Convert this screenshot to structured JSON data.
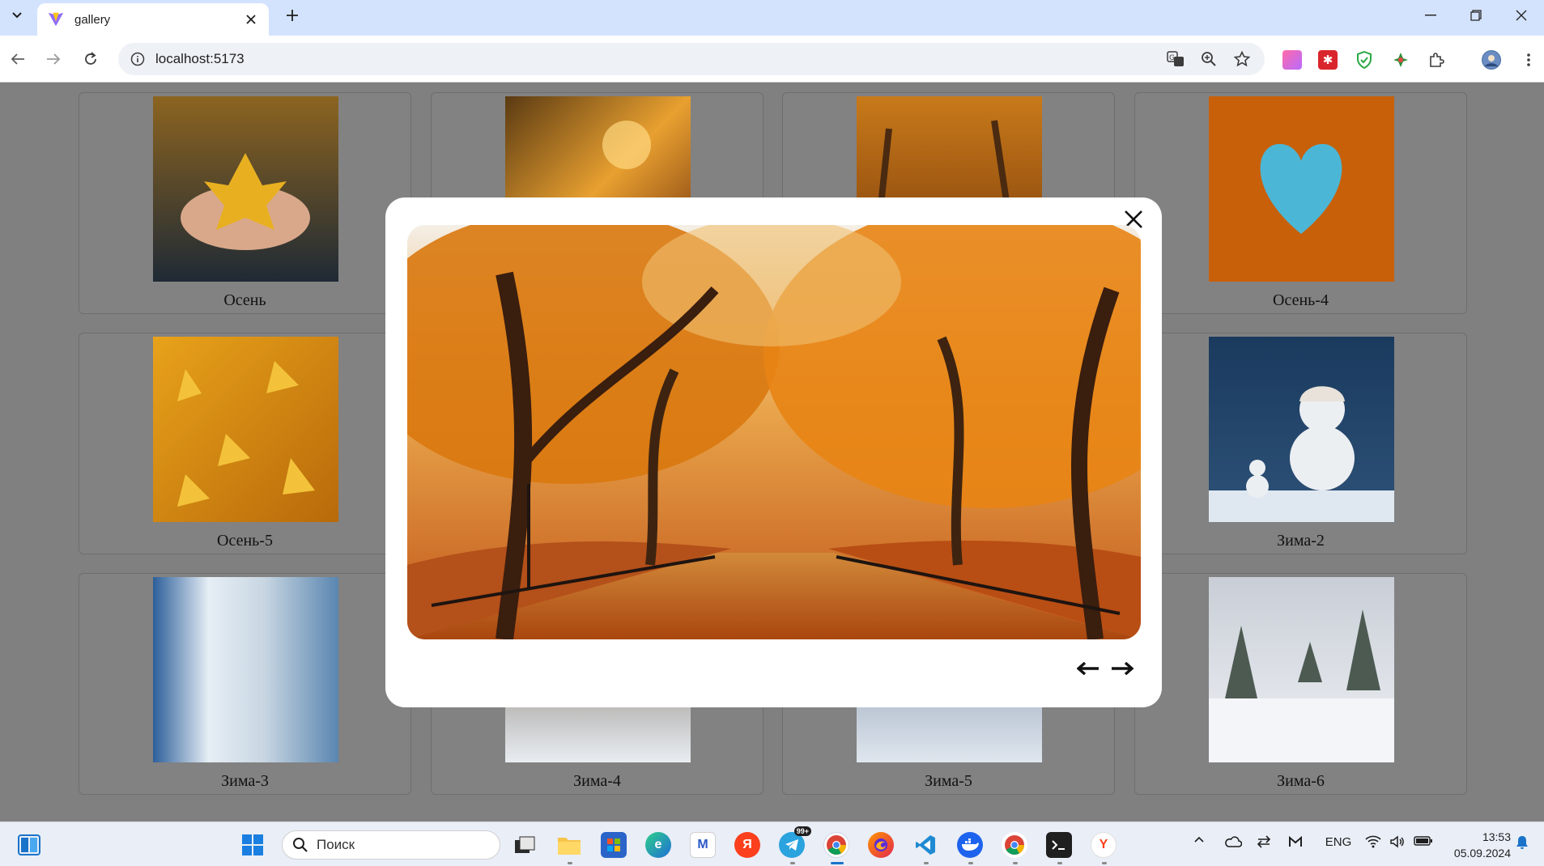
{
  "browser": {
    "tab_title": "gallery",
    "url": "localhost:5173"
  },
  "gallery": {
    "items": [
      {
        "label": "Осень"
      },
      {
        "label": ""
      },
      {
        "label": ""
      },
      {
        "label": "Осень-4"
      },
      {
        "label": "Осень-5"
      },
      {
        "label": ""
      },
      {
        "label": ""
      },
      {
        "label": "Зима-2"
      },
      {
        "label": "Зима-3"
      },
      {
        "label": "Зима-4"
      },
      {
        "label": "Зима-5"
      },
      {
        "label": "Зима-6"
      }
    ]
  },
  "taskbar": {
    "search_label": "Поиск",
    "language": "ENG",
    "time": "13:53",
    "date": "05.09.2024",
    "telegram_badge": "99+"
  },
  "colors": {
    "tabstrip": "#d3e3fd",
    "overlay": "#808080",
    "modal": "#ffffff"
  }
}
